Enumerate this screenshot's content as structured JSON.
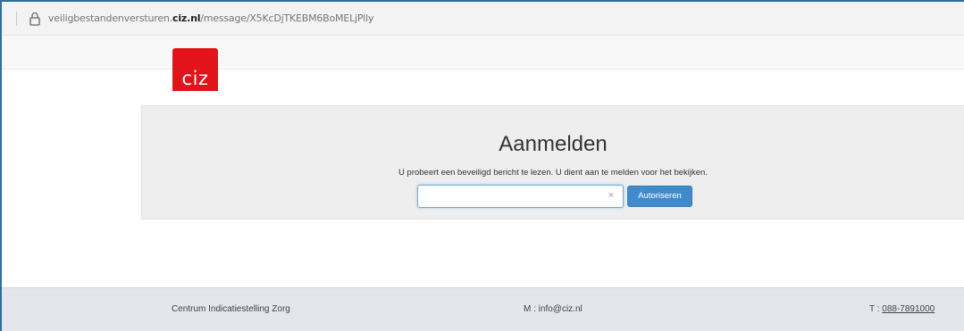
{
  "browser": {
    "url_prefix": "veiligbestandenversturen.",
    "url_domain": "ciz.nl",
    "url_path": "/message/X5KcDjTKEBM6BoMELjPlly",
    "lock_icon": "lock-icon"
  },
  "logo": {
    "text": "ciz",
    "color": "#e3131b"
  },
  "login": {
    "title": "Aanmelden",
    "description": "U probeert een beveiligd bericht te lezen. U dient aan te melden voor het bekijken.",
    "input_value": "",
    "input_placeholder": "",
    "clear_symbol": "×",
    "submit_label": "Autoriseren",
    "accent": "#428bca"
  },
  "footer": {
    "organization": "Centrum Indicatiestelling Zorg",
    "mail_label": "M : info@ciz.nl",
    "tel_prefix": "T : ",
    "tel_number": "088-7891000"
  }
}
